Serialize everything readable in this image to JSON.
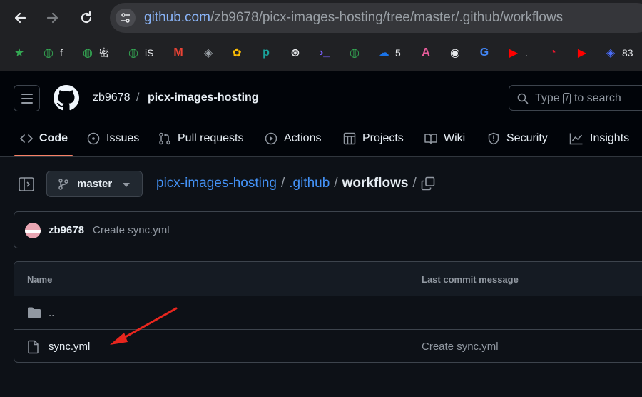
{
  "browser": {
    "url_host": "github.com",
    "url_path": "/zb9678/picx-images-hosting/tree/master/.github/workflows",
    "bookmarks": [
      {
        "label": "",
        "icon": "star-icon",
        "color": "#34a853"
      },
      {
        "label": "f",
        "icon": "globe-icon",
        "color": "#34a853"
      },
      {
        "label": "密",
        "icon": "globe-icon",
        "color": "#34a853"
      },
      {
        "label": "iS",
        "icon": "globe-icon",
        "color": "#34a853"
      },
      {
        "label": "",
        "icon": "gmail-icon",
        "color": "#ea4335"
      },
      {
        "label": "",
        "icon": "app-icon",
        "color": "#9aa0a6"
      },
      {
        "label": "",
        "icon": "photos-icon",
        "color": "#fbbc04"
      },
      {
        "label": "",
        "icon": "p-icon",
        "color": "#1aa39b"
      },
      {
        "label": "",
        "icon": "openai-icon",
        "color": "#e8eaed"
      },
      {
        "label": "",
        "icon": "terminal-icon",
        "color": "#7b61ff"
      },
      {
        "label": "",
        "icon": "globe-icon",
        "color": "#34a853"
      },
      {
        "label": "5",
        "icon": "onedrive-icon",
        "color": "#1a73e8"
      },
      {
        "label": "",
        "icon": "translate-icon",
        "color": "#e95c9b"
      },
      {
        "label": "",
        "icon": "github-icon",
        "color": "#e8eaed"
      },
      {
        "label": "",
        "icon": "google-icon",
        "color": "#4285f4"
      },
      {
        "label": ".",
        "icon": "youtube-icon",
        "color": "#ff0000"
      },
      {
        "label": "",
        "icon": "weibo-icon",
        "color": "#e6162d"
      },
      {
        "label": "",
        "icon": "youtube-icon",
        "color": "#ff0000"
      },
      {
        "label": "83",
        "icon": "app-icon",
        "color": "#4a6cf7"
      }
    ]
  },
  "header": {
    "owner": "zb9678",
    "separator": "/",
    "repo": "picx-images-hosting",
    "search_text_before": "Type",
    "search_key": "/",
    "search_text_after": "to search"
  },
  "tabs": [
    {
      "label": "Code",
      "icon": "code-icon"
    },
    {
      "label": "Issues",
      "icon": "issue-icon"
    },
    {
      "label": "Pull requests",
      "icon": "pull-request-icon"
    },
    {
      "label": "Actions",
      "icon": "play-icon"
    },
    {
      "label": "Projects",
      "icon": "table-icon"
    },
    {
      "label": "Wiki",
      "icon": "book-icon"
    },
    {
      "label": "Security",
      "icon": "shield-icon"
    },
    {
      "label": "Insights",
      "icon": "graph-icon"
    }
  ],
  "breadcrumb": {
    "branch": "master",
    "repo_link": "picx-images-hosting",
    "dir_link": ".github",
    "current": "workflows",
    "slash": "/"
  },
  "commit": {
    "author": "zb9678",
    "message": "Create sync.yml"
  },
  "files": {
    "col_name": "Name",
    "col_message": "Last commit message",
    "rows": [
      {
        "name": "..",
        "type": "folder",
        "message": ""
      },
      {
        "name": "sync.yml",
        "type": "file",
        "message": "Create sync.yml"
      }
    ]
  },
  "colors": {
    "accent_link": "#4493f8",
    "tab_underline": "#f78166",
    "annotation_arrow": "#e8261e"
  }
}
